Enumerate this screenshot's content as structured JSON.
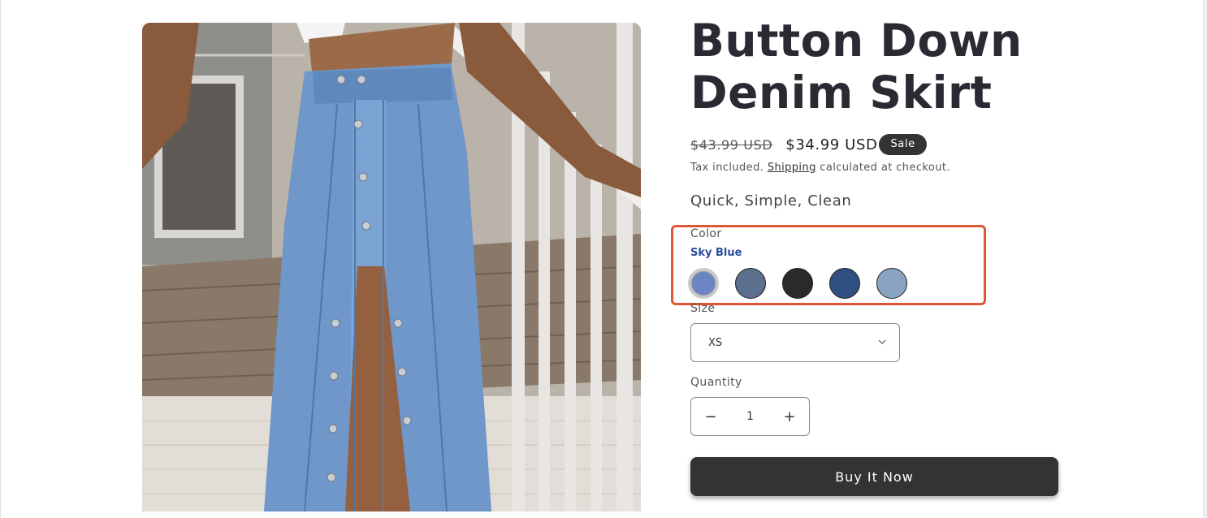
{
  "product": {
    "title": "Button Down Denim Skirt",
    "price_original": "$43.99 USD",
    "price_sale": "$34.99 USD",
    "sale_badge": "Sale",
    "tax_prefix": "Tax included.",
    "shipping_link": "Shipping",
    "tax_suffix": "calculated at checkout.",
    "tagline": "Quick, Simple, Clean"
  },
  "color": {
    "label": "Color",
    "selected": "Sky Blue",
    "swatches": [
      {
        "name": "sky-blue",
        "hex": "#6b84c4"
      },
      {
        "name": "slate",
        "hex": "#5c6f8d"
      },
      {
        "name": "black",
        "hex": "#2a2a2a"
      },
      {
        "name": "navy",
        "hex": "#2f5081"
      },
      {
        "name": "light-blue",
        "hex": "#8aa3c3"
      }
    ]
  },
  "size": {
    "label": "Size",
    "value": "XS"
  },
  "quantity": {
    "label": "Quantity",
    "value": "1",
    "minus": "−",
    "plus": "+"
  },
  "buy_label": "Buy It Now",
  "colors": {
    "highlight": "#e05535",
    "button_bg": "#333333",
    "selected_color_text": "#2b4f9c"
  }
}
